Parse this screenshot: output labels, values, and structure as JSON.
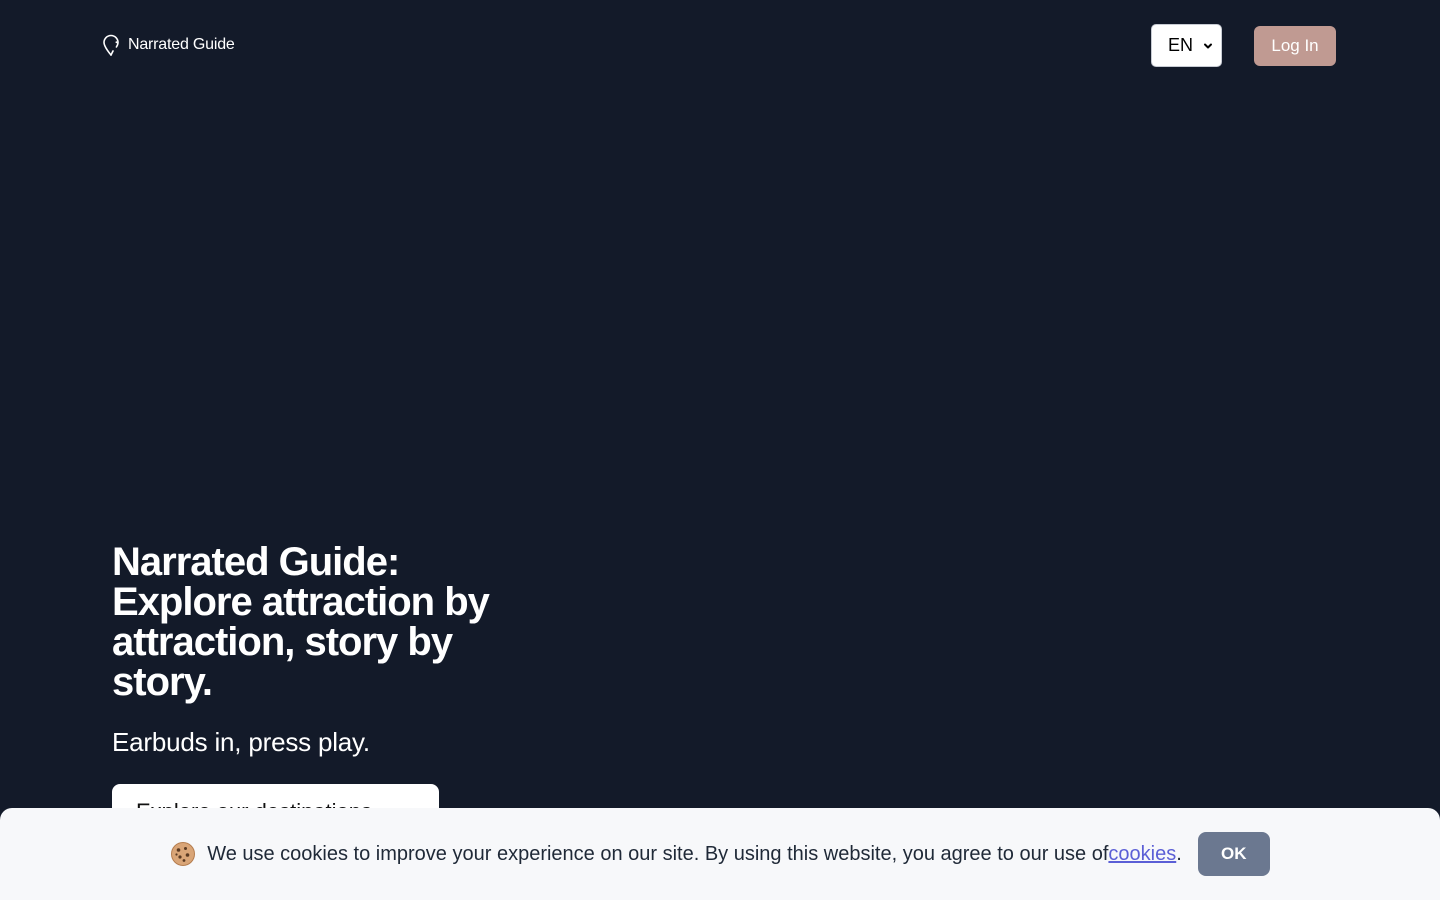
{
  "header": {
    "brand_name": "Narrated Guide",
    "brand_icon": "map-pin-icon",
    "language": {
      "selected": "EN"
    },
    "login_label": "Log In"
  },
  "hero": {
    "title": "Narrated Guide: Explore attraction by attraction, story by story.",
    "subtitle": "Earbuds in, press play.",
    "cta_label": "Explore our destinations →"
  },
  "cookie_banner": {
    "icon": "cookie-icon",
    "text": "We use cookies to improve your experience on our site. By using this website, you agree to our use of ",
    "link_label": "cookies",
    "trailing": ".",
    "ok_label": "OK"
  },
  "colors": {
    "background": "#131a29",
    "login_button": "#c09a92",
    "ok_button": "#6b7890",
    "link": "#5b5fd6",
    "banner": "#f7f8fa"
  }
}
